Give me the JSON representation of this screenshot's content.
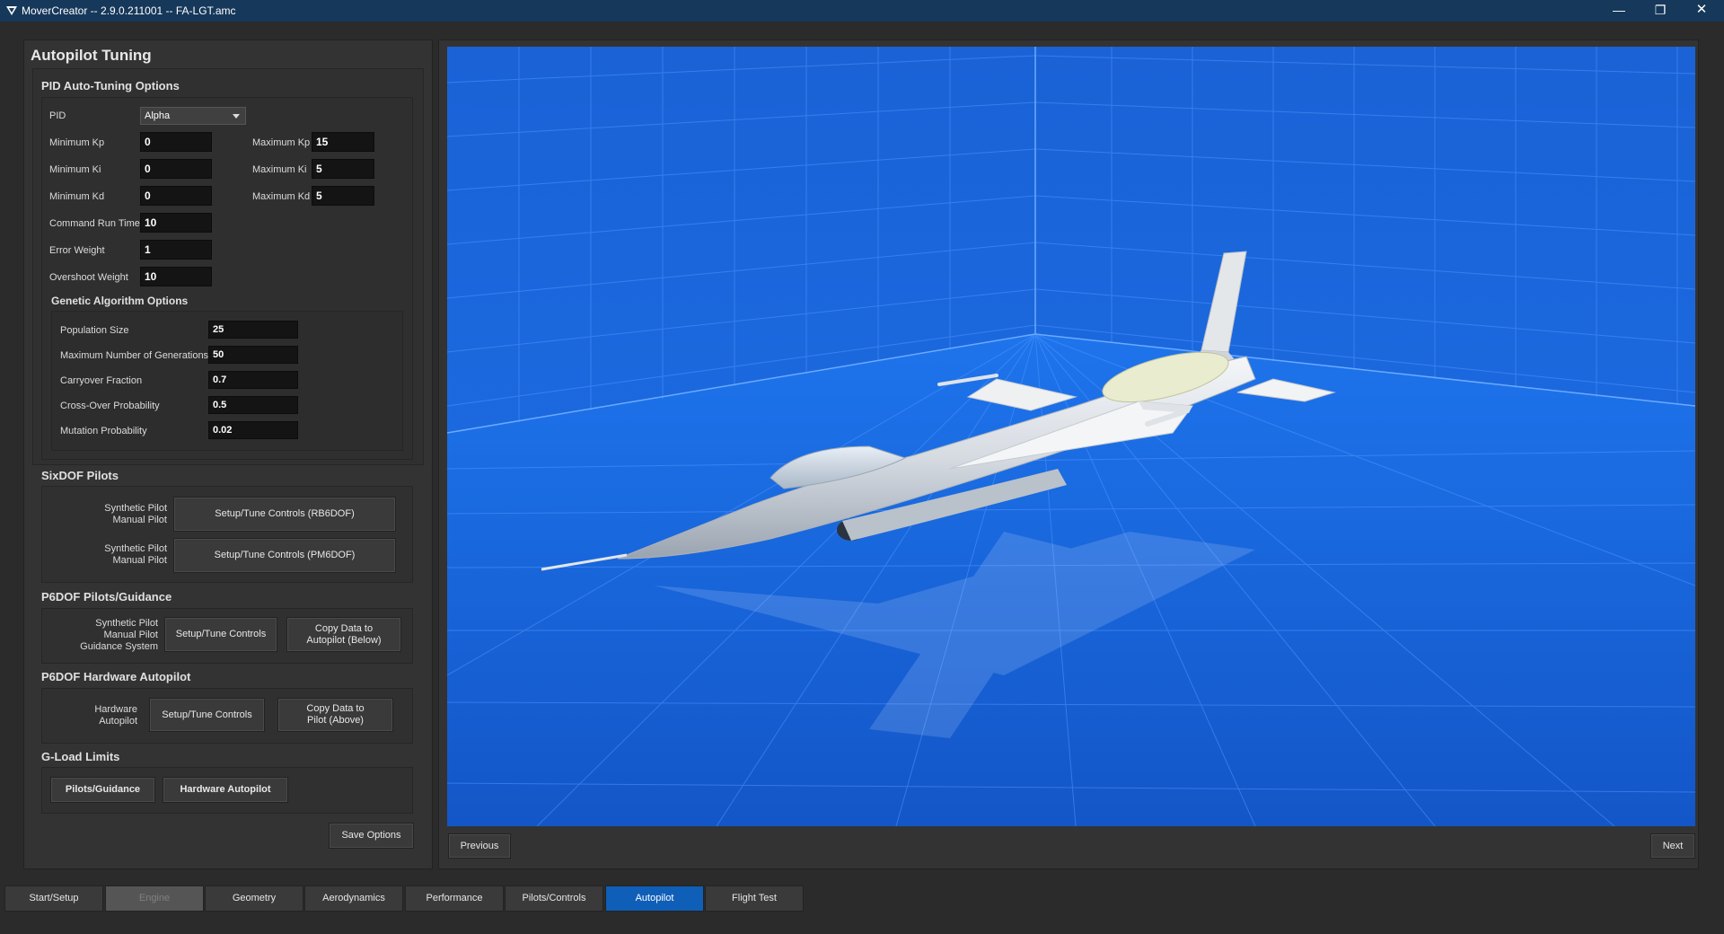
{
  "window": {
    "title": "MoverCreator -- 2.9.0.211001 -- FA-LGT.amc",
    "minimize": "—",
    "restore": "❐",
    "close": "✕"
  },
  "panel": {
    "title": "Autopilot Tuning",
    "pid_section": {
      "title": "PID Auto-Tuning Options",
      "pid_label": "PID",
      "pid_value": "Alpha",
      "min_kp_label": "Minimum Kp",
      "min_kp": "0",
      "max_kp_label": "Maximum Kp",
      "max_kp": "15",
      "min_ki_label": "Minimum Ki",
      "min_ki": "0",
      "max_ki_label": "Maximum Ki",
      "max_ki": "5",
      "min_kd_label": "Minimum Kd",
      "min_kd": "0",
      "max_kd_label": "Maximum Kd",
      "max_kd": "5",
      "run_time_label": "Command Run Time",
      "run_time": "10",
      "error_weight_label": "Error Weight",
      "error_weight": "1",
      "overshoot_label": "Overshoot Weight",
      "overshoot": "10"
    },
    "ga_section": {
      "title": "Genetic Algorithm Options",
      "population_label": "Population Size",
      "population": "25",
      "generations_label": "Maximum Number of Generations",
      "generations": "50",
      "carryover_label": "Carryover Fraction",
      "carryover": "0.7",
      "crossover_label": "Cross-Over Probability",
      "crossover": "0.5",
      "mutation_label": "Mutation Probability",
      "mutation": "0.02"
    },
    "sixdof": {
      "title": "SixDOF Pilots",
      "row1_label_a": "Synthetic Pilot",
      "row1_label_b": "Manual Pilot",
      "row1_button": "Setup/Tune Controls (RB6DOF)",
      "row2_label_a": "Synthetic Pilot",
      "row2_label_b": "Manual Pilot",
      "row2_button": "Setup/Tune Controls (PM6DOF)"
    },
    "p6dof_guidance": {
      "title": "P6DOF Pilots/Guidance",
      "label_a": "Synthetic Pilot",
      "label_b": "Manual Pilot",
      "label_c": "Guidance System",
      "setup_button": "Setup/Tune Controls",
      "copy_button_a": "Copy Data to",
      "copy_button_b": "Autopilot (Below)"
    },
    "p6dof_hw": {
      "title": "P6DOF Hardware Autopilot",
      "label_a": "Hardware",
      "label_b": "Autopilot",
      "setup_button": "Setup/Tune Controls",
      "copy_button_a": "Copy Data to",
      "copy_button_b": "Pilot (Above)"
    },
    "gload": {
      "title": "G-Load Limits",
      "pilots_button": "Pilots/Guidance",
      "hw_button": "Hardware Autopilot"
    },
    "save_button": "Save Options"
  },
  "nav": {
    "previous": "Previous",
    "next": "Next"
  },
  "tabs": [
    "Start/Setup",
    "Engine",
    "Geometry",
    "Aerodynamics",
    "Performance",
    "Pilots/Controls",
    "Autopilot",
    "Flight Test"
  ],
  "active_tab": "Autopilot",
  "disabled_tab": "Engine",
  "colors": {
    "viewport_bg": "#1a63d8",
    "grid_line": "#5aa0ff",
    "active_tab": "#0f5fb8",
    "titlebar": "#16385a"
  }
}
